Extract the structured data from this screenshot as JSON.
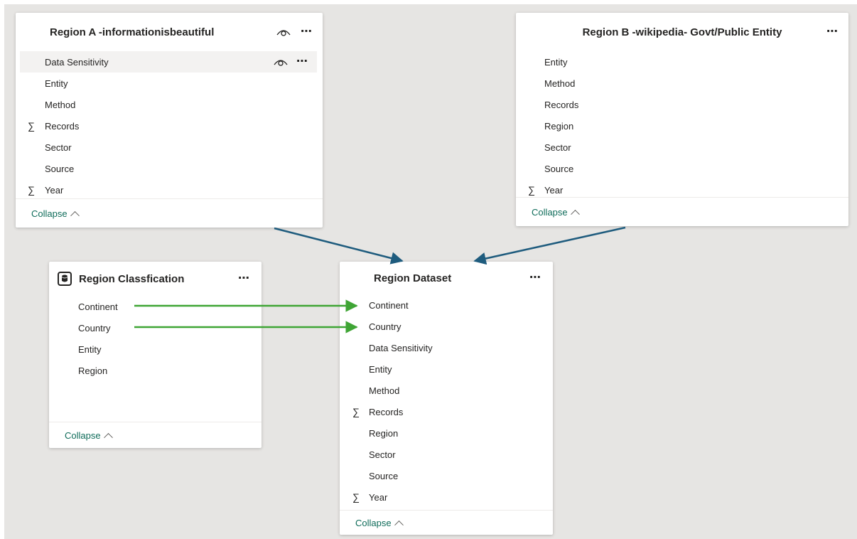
{
  "tables": {
    "region_a": {
      "title": "Region A -informationisbeautiful",
      "fields": [
        {
          "label": "Data Sensitivity",
          "sigma": false
        },
        {
          "label": "Entity",
          "sigma": false
        },
        {
          "label": "Method",
          "sigma": false
        },
        {
          "label": "Records",
          "sigma": true
        },
        {
          "label": "Sector",
          "sigma": false
        },
        {
          "label": "Source",
          "sigma": false
        },
        {
          "label": "Year",
          "sigma": true
        }
      ],
      "collapse_label": "Collapse"
    },
    "region_b": {
      "title": "Region B -wikipedia- Govt/Public Entity",
      "fields": [
        {
          "label": "Entity",
          "sigma": false
        },
        {
          "label": "Method",
          "sigma": false
        },
        {
          "label": "Records",
          "sigma": false
        },
        {
          "label": "Region",
          "sigma": false
        },
        {
          "label": "Sector",
          "sigma": false
        },
        {
          "label": "Source",
          "sigma": false
        },
        {
          "label": "Year",
          "sigma": true
        }
      ],
      "collapse_label": "Collapse"
    },
    "region_classification": {
      "title": "Region Classfication",
      "fields": [
        {
          "label": "Continent",
          "sigma": false
        },
        {
          "label": "Country",
          "sigma": false
        },
        {
          "label": "Entity",
          "sigma": false
        },
        {
          "label": "Region",
          "sigma": false
        }
      ],
      "collapse_label": "Collapse"
    },
    "region_dataset": {
      "title": "Region Dataset",
      "fields": [
        {
          "label": "Continent",
          "sigma": false
        },
        {
          "label": "Country",
          "sigma": false
        },
        {
          "label": "Data Sensitivity",
          "sigma": false
        },
        {
          "label": "Entity",
          "sigma": false
        },
        {
          "label": "Method",
          "sigma": false
        },
        {
          "label": "Records",
          "sigma": true
        },
        {
          "label": "Region",
          "sigma": false
        },
        {
          "label": "Sector",
          "sigma": false
        },
        {
          "label": "Source",
          "sigma": false
        },
        {
          "label": "Year",
          "sigma": true
        }
      ],
      "collapse_label": "Collapse"
    }
  },
  "icons": {
    "more": "⋯",
    "sigma": "∑"
  },
  "colors": {
    "canvas": "#e6e5e3",
    "table_link": "#1f5c7e",
    "column_link": "#3fa535",
    "collapse_text": "#0f6c5a"
  }
}
